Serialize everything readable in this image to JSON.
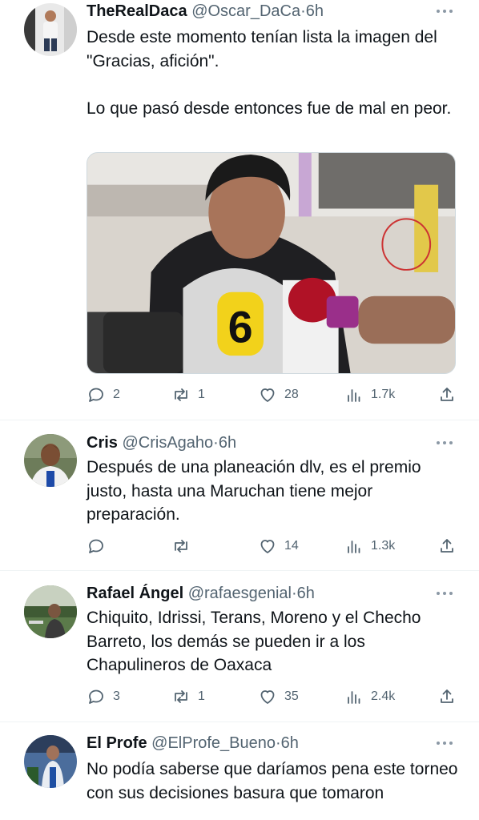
{
  "tweets": [
    {
      "name": "TheRealDaca",
      "handle": "@Oscar_DaCa",
      "separator": "·",
      "time": "6h",
      "text": "Desde este momento tenían lista la imagen del \"Gracias, afición\".\n\nLo que pasó desde entonces fue de mal en peor.",
      "media_caption": "6",
      "reply_count": "2",
      "retweet_count": "1",
      "like_count": "28",
      "view_count": "1.7k"
    },
    {
      "name": "Cris",
      "handle": "@CrisAgaho",
      "separator": "·",
      "time": "6h",
      "text": "Después de una planeación dlv, es el premio justo, hasta una Maruchan tiene mejor preparación.",
      "reply_count": "",
      "retweet_count": "",
      "like_count": "14",
      "view_count": "1.3k"
    },
    {
      "name": "Rafael Ángel",
      "handle": "@rafaesgenial",
      "separator": "·",
      "time": "6h",
      "text": "Chiquito, Idrissi, Terans, Moreno y el Checho Barreto, los demás se pueden ir a los Chapulineros de Oaxaca",
      "reply_count": "3",
      "retweet_count": "1",
      "like_count": "35",
      "view_count": "2.4k"
    },
    {
      "name": "El Profe",
      "handle": "@ElProfe_Bueno",
      "separator": "·",
      "time": "6h",
      "text": "No podía saberse que daríamos pena este torneo con sus decisiones basura que tomaron"
    }
  ],
  "icons": {
    "reply": "reply-icon",
    "retweet": "retweet-icon",
    "like": "heart-icon",
    "views": "views-icon",
    "share": "share-icon",
    "more": "more-options-icon"
  },
  "colors": {
    "text": "#0f1419",
    "secondary": "#536471",
    "separator": "#eff3f4"
  }
}
